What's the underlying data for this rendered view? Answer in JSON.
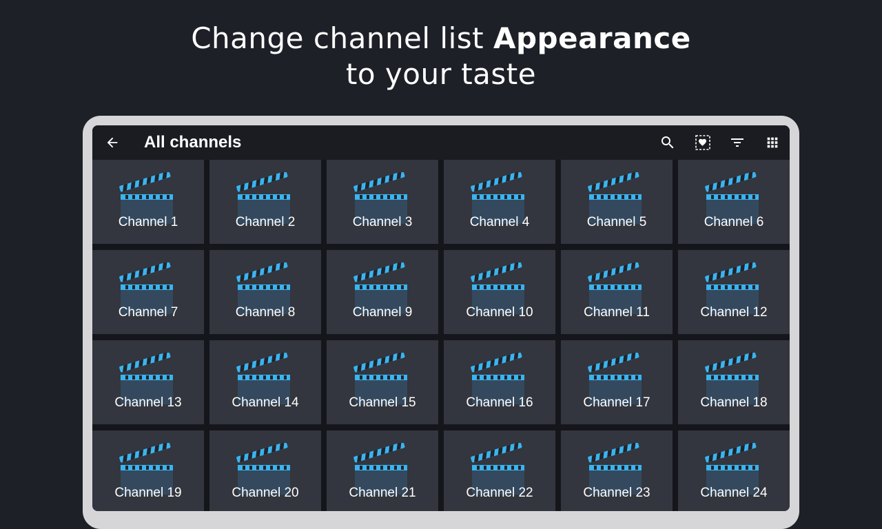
{
  "headline": {
    "line1_regular": "Change channel list ",
    "line1_bold": "Appearance",
    "line2": "to your taste"
  },
  "toolbar": {
    "title": "All channels",
    "back_icon": "arrow-left-icon",
    "icons": [
      "search-icon",
      "favorite-frame-icon",
      "filter-icon",
      "grid-view-icon"
    ]
  },
  "colors": {
    "background": "#1e2028",
    "tile": "#33363e",
    "accent": "#3ab4f0"
  },
  "channels": [
    {
      "label": "Channel 1"
    },
    {
      "label": "Channel 2"
    },
    {
      "label": "Channel 3"
    },
    {
      "label": "Channel 4"
    },
    {
      "label": "Channel 5"
    },
    {
      "label": "Channel 6"
    },
    {
      "label": "Channel 7"
    },
    {
      "label": "Channel 8"
    },
    {
      "label": "Channel 9"
    },
    {
      "label": "Channel 10"
    },
    {
      "label": "Channel 11"
    },
    {
      "label": "Channel 12"
    },
    {
      "label": "Channel 13"
    },
    {
      "label": "Channel 14"
    },
    {
      "label": "Channel 15"
    },
    {
      "label": "Channel 16"
    },
    {
      "label": "Channel 17"
    },
    {
      "label": "Channel 18"
    },
    {
      "label": "Channel 19"
    },
    {
      "label": "Channel 20"
    },
    {
      "label": "Channel 21"
    },
    {
      "label": "Channel 22"
    },
    {
      "label": "Channel 23"
    },
    {
      "label": "Channel 24"
    }
  ]
}
